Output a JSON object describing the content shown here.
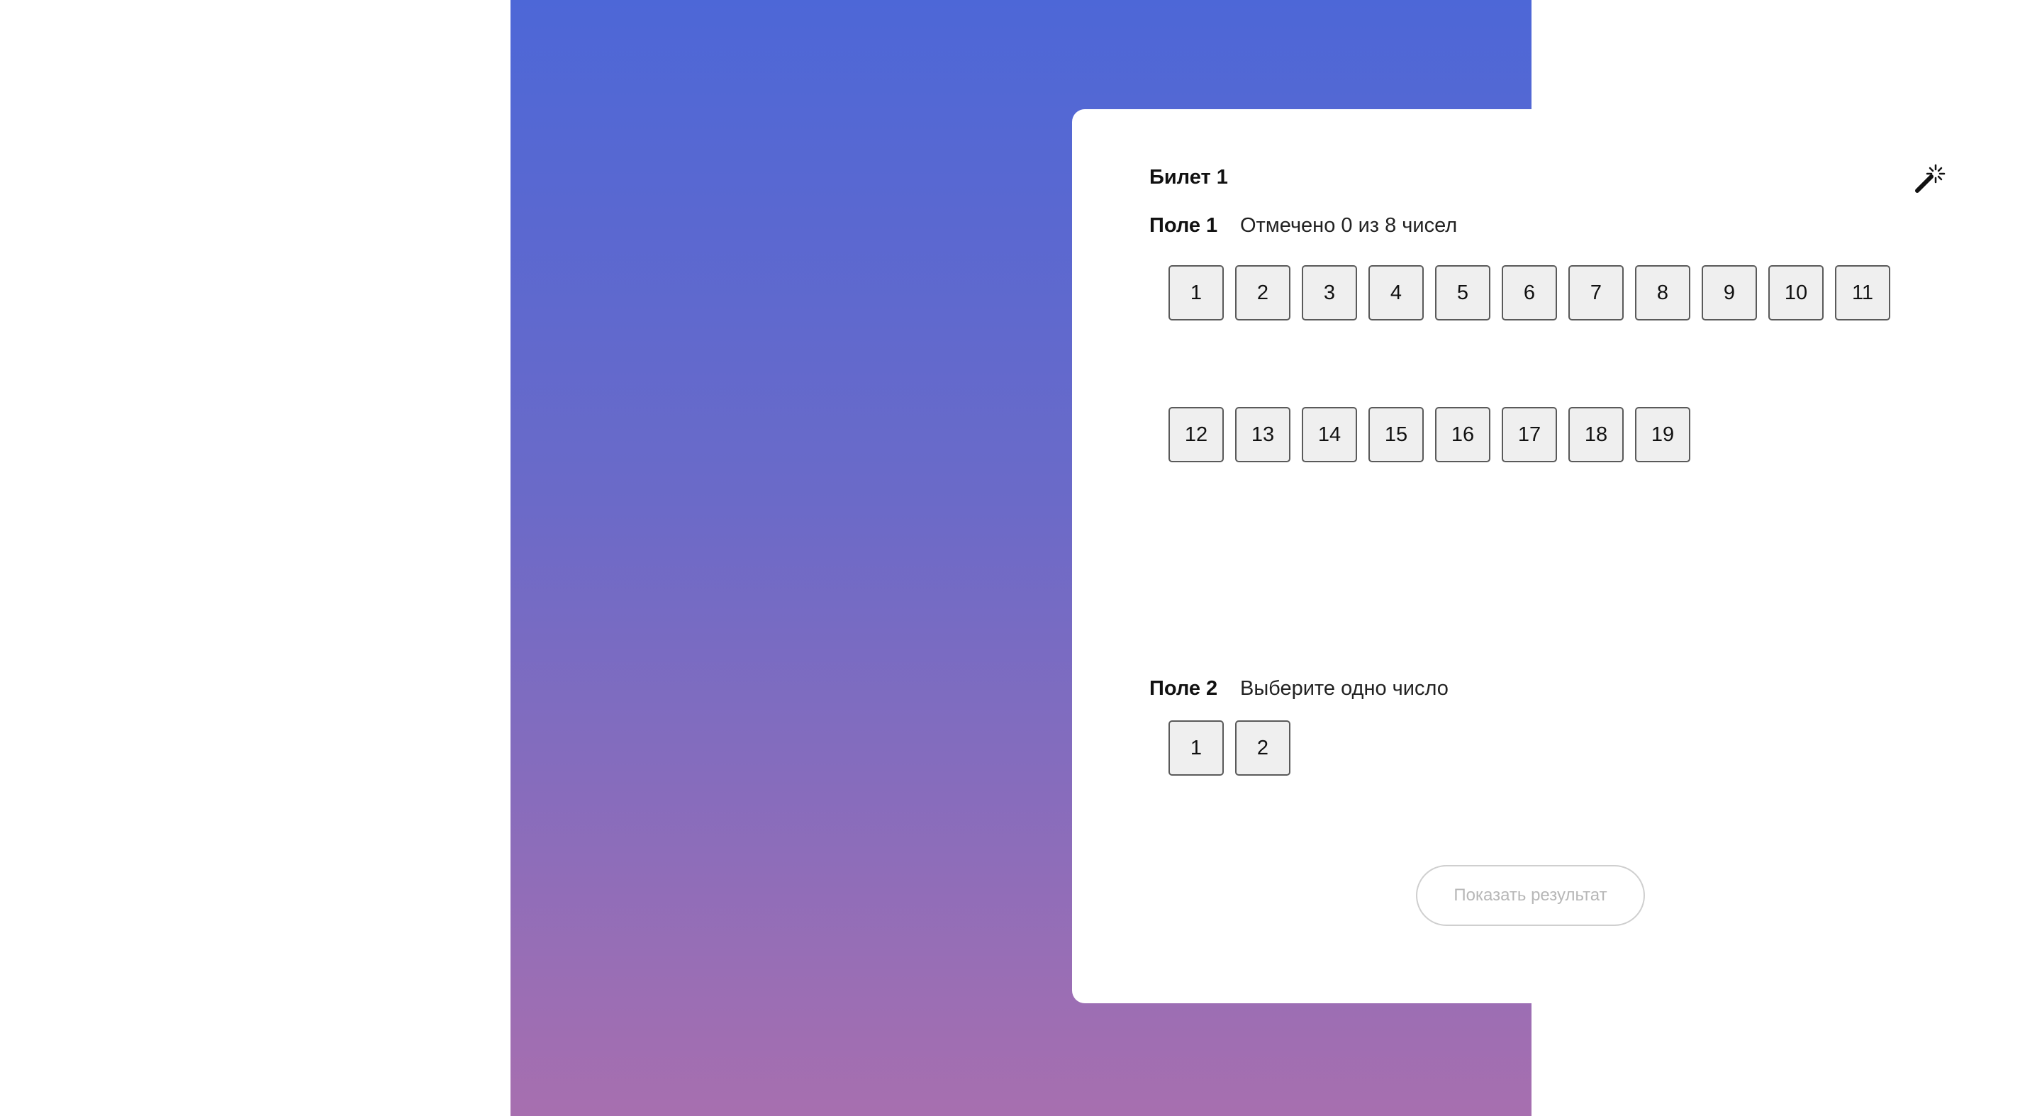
{
  "colors": {
    "gradient_top": "#4d67d7",
    "gradient_bottom": "#a76faf",
    "card": "#ffffff",
    "cell_background": "#efefef",
    "cell_border": "#5a5a5a",
    "button_disabled_text": "#b7b7b7"
  },
  "ticket": {
    "title": "Билет 1",
    "magic_icon": "magic-wand-icon"
  },
  "field1": {
    "label": "Поле 1",
    "hint": "Отмечено 0 из 8 чисел",
    "numbers": [
      "1",
      "2",
      "3",
      "4",
      "5",
      "6",
      "7",
      "8",
      "9",
      "10",
      "11",
      "12",
      "13",
      "14",
      "15",
      "16",
      "17",
      "18",
      "19"
    ]
  },
  "field2": {
    "label": "Поле 2",
    "hint": "Выберите одно число",
    "numbers": [
      "1",
      "2"
    ]
  },
  "actions": {
    "show_result_label": "Показать результат",
    "show_result_enabled": false
  }
}
